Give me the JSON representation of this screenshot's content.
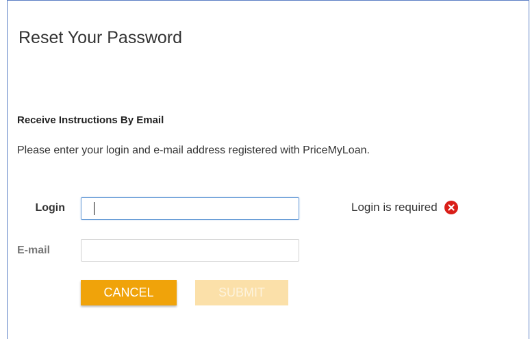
{
  "dialog": {
    "title": "Reset Your Password",
    "subheading": "Receive Instructions By Email",
    "instructions": "Please enter your login and e-mail address registered with PriceMyLoan."
  },
  "form": {
    "login": {
      "label": "Login",
      "value": "",
      "placeholder": "",
      "focused": true,
      "validation_message": "Login is required",
      "validation_icon": "error-circle-x-icon"
    },
    "email": {
      "label": "E-mail",
      "value": "",
      "placeholder": ""
    },
    "buttons": {
      "cancel_label": "CANCEL",
      "submit_label": "SUBMIT",
      "submit_disabled": true
    }
  },
  "colors": {
    "border_accent": "#5b7fc4",
    "button_primary": "#f0a30a",
    "button_disabled": "#fbe0a9",
    "error_red": "#d91e18",
    "focus_border": "#6c9fd8"
  }
}
